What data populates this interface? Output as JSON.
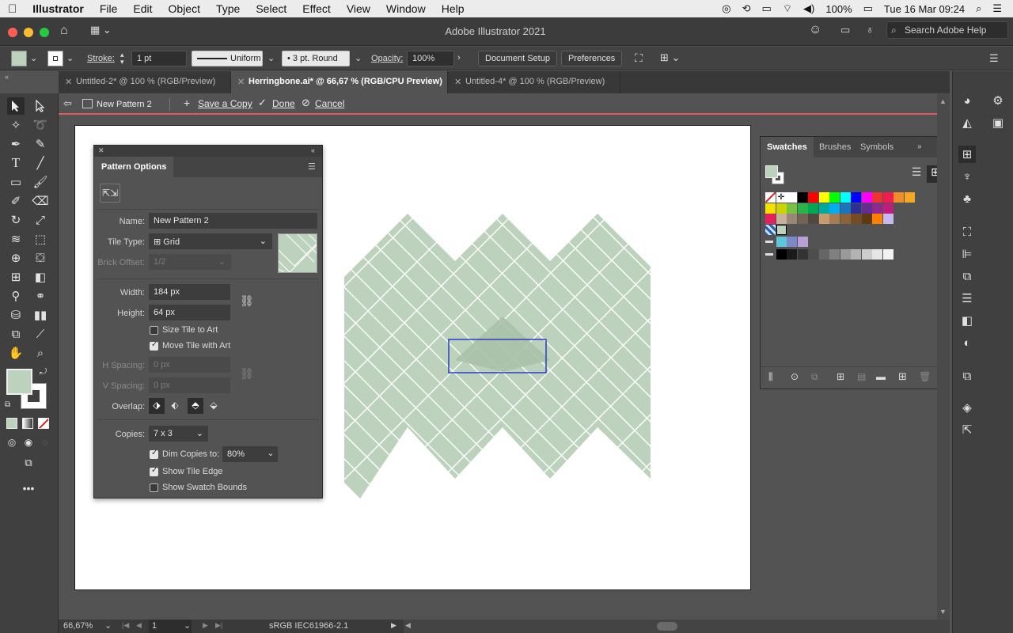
{
  "menubar": {
    "apple": "",
    "app": "Illustrator",
    "items": [
      "File",
      "Edit",
      "Object",
      "Type",
      "Select",
      "Effect",
      "View",
      "Window",
      "Help"
    ],
    "battery": "100%",
    "datetime": "Tue 16 Mar  09:24"
  },
  "titlebar": {
    "title": "Adobe Illustrator 2021",
    "search_placeholder": "Search Adobe Help"
  },
  "controlbar": {
    "stroke_label": "Stroke:",
    "stroke_weight": "1 pt",
    "stroke_profile": "Uniform",
    "brush": "3 pt. Round",
    "opacity_label": "Opacity:",
    "opacity_value": "100%",
    "document_setup": "Document Setup",
    "preferences": "Preferences"
  },
  "tabs": [
    {
      "label": "Untitled-2* @ 100 % (RGB/Preview)",
      "active": false
    },
    {
      "label": "Herringbone.ai* @ 66,67 % (RGB/CPU Preview)",
      "active": true
    },
    {
      "label": "Untitled-4* @ 100 % (RGB/Preview)",
      "active": false
    }
  ],
  "patternbar": {
    "pattern_name": "New Pattern 2",
    "save_copy": "Save a Copy",
    "done": "Done",
    "cancel": "Cancel"
  },
  "pattern_options": {
    "title": "Pattern Options",
    "name_label": "Name:",
    "name_value": "New Pattern 2",
    "tile_type_label": "Tile Type:",
    "tile_type_value": "Grid",
    "brick_offset_label": "Brick Offset:",
    "brick_offset_value": "1/2",
    "width_label": "Width:",
    "width_value": "184 px",
    "height_label": "Height:",
    "height_value": "64 px",
    "size_tile_to_art": "Size Tile to Art",
    "move_tile_with_art": "Move Tile with Art",
    "h_spacing_label": "H Spacing:",
    "h_spacing_value": "0 px",
    "v_spacing_label": "V Spacing:",
    "v_spacing_value": "0 px",
    "overlap_label": "Overlap:",
    "copies_label": "Copies:",
    "copies_value": "7 x 3",
    "dim_copies_label": "Dim Copies to:",
    "dim_copies_value": "80%",
    "show_tile_edge": "Show Tile Edge",
    "show_swatch_bounds": "Show Swatch Bounds",
    "checks": {
      "size_tile": false,
      "move_tile": true,
      "dim_copies": true,
      "tile_edge": true,
      "swatch_bounds": false
    }
  },
  "swatches": {
    "tabs": [
      "Swatches",
      "Brushes",
      "Symbols"
    ],
    "row1": [
      "#ffffff",
      "#000000",
      "#ff0000",
      "#ffff00",
      "#00ff00",
      "#00ffff",
      "#0000ff",
      "#ff00ff",
      "#ee3333",
      "#ee1f50",
      "#f28c28",
      "#f7a823"
    ],
    "row2": [
      "#f5e000",
      "#c9d400",
      "#7ac143",
      "#2bb34a",
      "#00a651",
      "#00a99d",
      "#00aeef",
      "#1b75bb",
      "#2e3192",
      "#662d91",
      "#92278f",
      "#bd1e7e"
    ],
    "row3": [
      "#e61f5d",
      "#c7b299",
      "#998675",
      "#736357",
      "#534741",
      "#c69c6d",
      "#a67c52",
      "#8c6239",
      "#754c24",
      "#603913",
      "#ff7f00",
      "#c8b8f0"
    ],
    "greys": [
      "#000000",
      "#1a1a1a",
      "#333333",
      "#4d4d4d",
      "#666666",
      "#808080",
      "#999999",
      "#b3b3b3",
      "#cccccc",
      "#e6e6e6",
      "#f2f2f2"
    ],
    "group1": [
      "#5ec6d6",
      "#7b89c8",
      "#b7a0d6"
    ]
  },
  "statusbar": {
    "zoom": "66,67%",
    "page": "1",
    "profile": "sRGB IEC61966-2.1"
  },
  "colors": {
    "pattern_fill": "#bdd2bc",
    "tile_bounds": "#2a3cc0",
    "accent_red": "#e05b5b"
  }
}
